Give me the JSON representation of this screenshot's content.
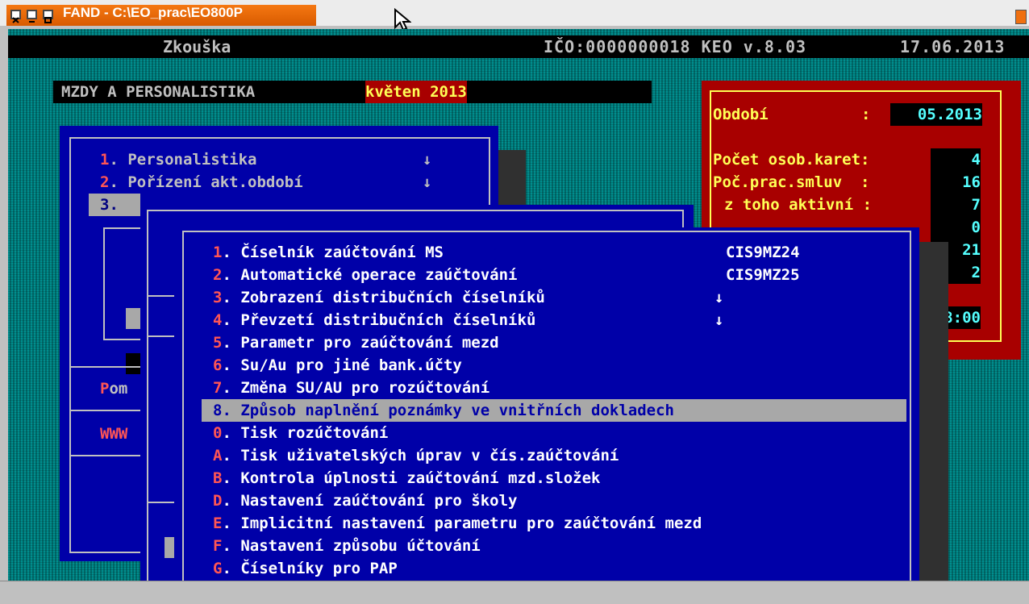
{
  "window": {
    "title": "FAND - C:\\EO_prac\\EO800P"
  },
  "header": {
    "app_title": "Zkouška",
    "ico_info": "IČO:0000000018 KEO v.8.03",
    "date": "17.06.2013"
  },
  "module": {
    "name": "MZDY A PERSONALISTIKA",
    "period_label": "květen 2013"
  },
  "info_panel": {
    "obdobi_label": "Období",
    "obdobi_value": "05.2013",
    "osob_karet_label": "Počet osob.karet:",
    "osob_karet_value": "4",
    "prac_smluv_label": "Poč.prac.smluv  :",
    "prac_smluv_value": "16",
    "aktivni_label": "z toho aktivní :",
    "aktivni_value": "7",
    "row4_value": "0",
    "row5_value": "21",
    "row6_value": "2",
    "time_fragment": "8:00"
  },
  "main_menu": {
    "items": [
      {
        "key": "1",
        "label": ". Personalistika",
        "arrow": "↓"
      },
      {
        "key": "2",
        "label": ". Pořízení akt.období",
        "arrow": "↓"
      },
      {
        "key": "3",
        "label": "."
      }
    ],
    "fragment_pom_key": "P",
    "fragment_pom": "om",
    "fragment_www": "WWW"
  },
  "submenu": {
    "items": [
      {
        "key": "1",
        "label": ". Číselník zaúčtování MS",
        "code": "CIS9MZ24",
        "arrow": ""
      },
      {
        "key": "2",
        "label": ". Automatické operace zaúčtování",
        "code": "CIS9MZ25",
        "arrow": ""
      },
      {
        "key": "3",
        "label": ". Zobrazení distribučních číselníků",
        "code": "",
        "arrow": "↓"
      },
      {
        "key": "4",
        "label": ". Převzetí distribučních číselníků",
        "code": "",
        "arrow": "↓"
      },
      {
        "key": "5",
        "label": ". Parametr pro zaúčtování mezd",
        "code": "",
        "arrow": ""
      },
      {
        "key": "6",
        "label": ". Su/Au pro jiné bank.účty",
        "code": "",
        "arrow": ""
      },
      {
        "key": "7",
        "label": ". Změna SU/AU pro rozúčtování",
        "code": "",
        "arrow": ""
      },
      {
        "key": "8",
        "label": ". Způsob naplnění poznámky ve vnitřních dokladech",
        "code": "",
        "arrow": ""
      },
      {
        "key": "0",
        "label": ". Tisk rozúčtování",
        "code": "",
        "arrow": ""
      },
      {
        "key": "A",
        "label": ". Tisk uživatelských úprav v čís.zaúčtování",
        "code": "",
        "arrow": ""
      },
      {
        "key": "B",
        "label": ". Kontrola úplnosti zaúčtování mzd.složek",
        "code": "",
        "arrow": ""
      },
      {
        "key": "D",
        "label": ". Nastavení zaúčtování pro školy",
        "code": "",
        "arrow": ""
      },
      {
        "key": "E",
        "label": ". Implicitní nastavení parametru pro zaúčtování mezd",
        "code": "",
        "arrow": ""
      },
      {
        "key": "F",
        "label": ". Nastavení způsobu účtování",
        "code": "",
        "arrow": ""
      },
      {
        "key": "G",
        "label": ". Číselníky pro PAP",
        "code": "",
        "arrow": ""
      }
    ],
    "selected_index": 7
  }
}
